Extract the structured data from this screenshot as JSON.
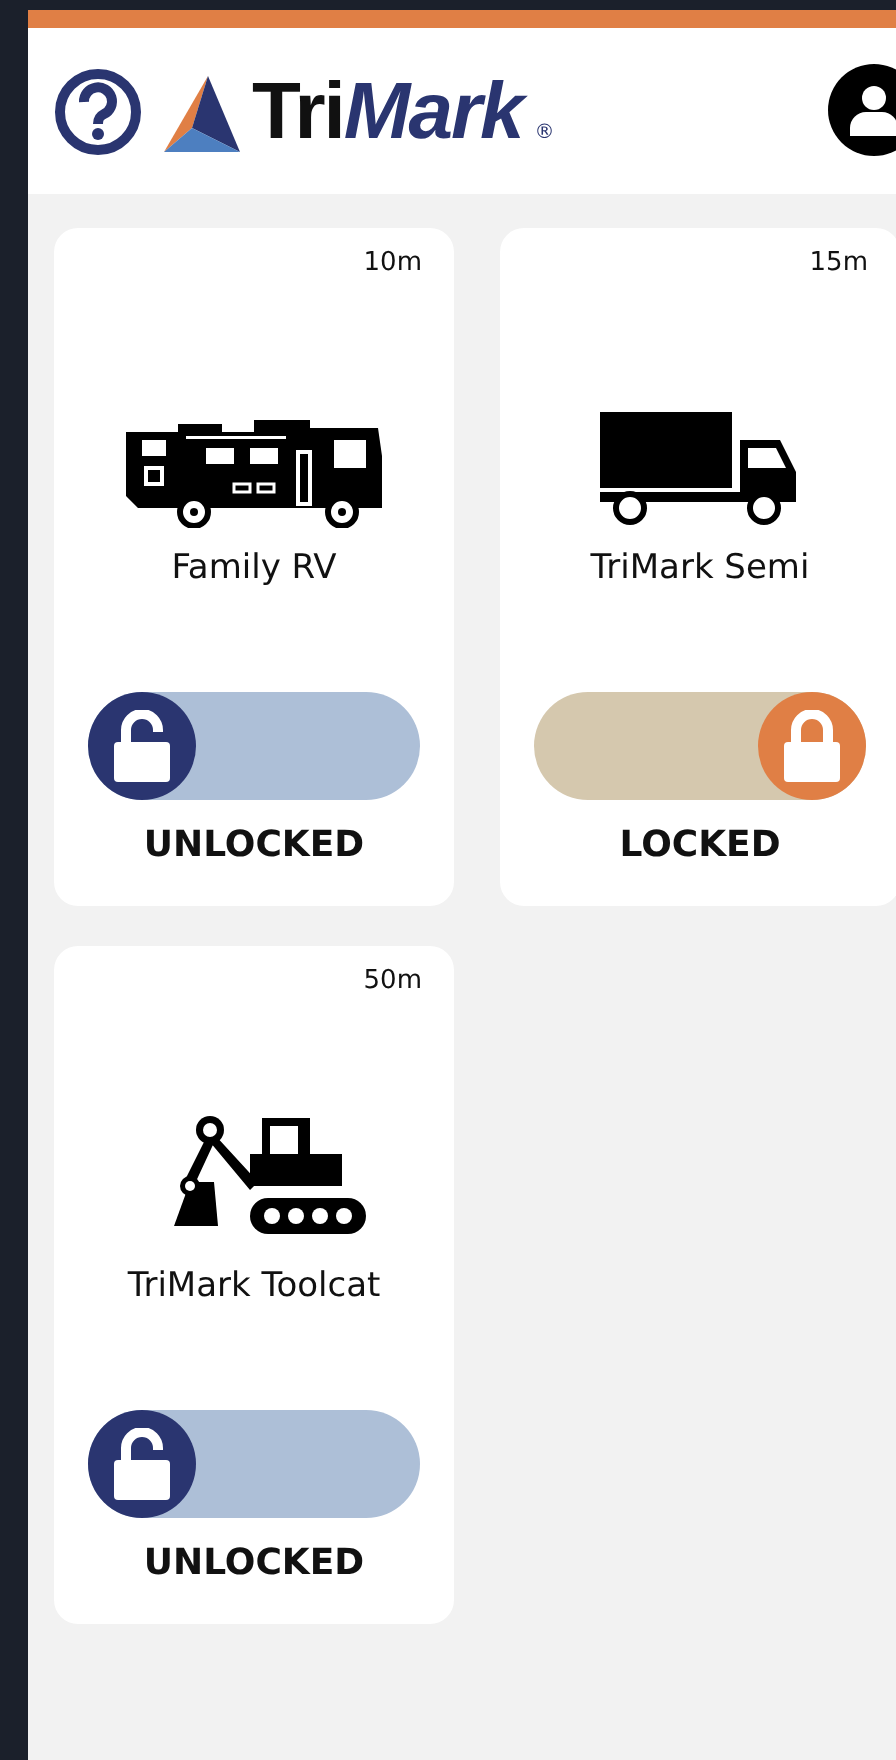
{
  "header": {
    "logo_main": "Tri",
    "logo_accent": "Mark",
    "registered": "®"
  },
  "vehicles": [
    {
      "kind": "rv",
      "name": "Family RV",
      "age": "10m",
      "locked": false,
      "status": "UNLOCKED"
    },
    {
      "kind": "truck",
      "name": "TriMark Semi",
      "age": "15m",
      "locked": true,
      "status": "LOCKED"
    },
    {
      "kind": "excavator",
      "name": "TriMark Toolcat",
      "age": "50m",
      "locked": false,
      "status": "UNLOCKED"
    }
  ]
}
